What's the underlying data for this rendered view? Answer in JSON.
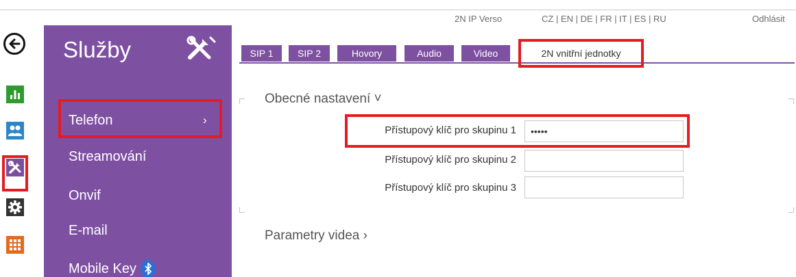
{
  "header": {
    "device_name": "2N IP Verso",
    "languages": "CZ | EN | DE | FR | IT | ES | RU",
    "logout": "Odhlásit"
  },
  "left_nav": {
    "items": [
      {
        "name": "status-icon",
        "color": "#2e9b2e"
      },
      {
        "name": "users-icon",
        "color": "#2c86c8"
      },
      {
        "name": "services-icon",
        "color": "#7b4f9e"
      },
      {
        "name": "system-icon",
        "color": "#333333"
      },
      {
        "name": "apps-icon",
        "color": "#e26b1d"
      }
    ]
  },
  "sidebar": {
    "title": "Služby",
    "items": [
      {
        "label": "Telefon"
      },
      {
        "label": "Streamování"
      },
      {
        "label": "Onvif"
      },
      {
        "label": "E-mail"
      },
      {
        "label": "Mobile Key"
      }
    ],
    "active_chevron": "›"
  },
  "tabs": [
    {
      "label": "SIP 1"
    },
    {
      "label": "SIP 2"
    },
    {
      "label": "Hovory"
    },
    {
      "label": "Audio"
    },
    {
      "label": "Video"
    },
    {
      "label": "2N vnitřní jednotky",
      "active": true
    }
  ],
  "sections": {
    "general_title": "Obecné nastavení ˅",
    "video_title": "Parametry videa ›"
  },
  "form": {
    "fields": [
      {
        "label": "Přístupový klíč pro skupinu 1",
        "value": "•••••"
      },
      {
        "label": "Přístupový klíč pro skupinu 2",
        "value": ""
      },
      {
        "label": "Přístupový klíč pro skupinu 3",
        "value": ""
      }
    ]
  },
  "colors": {
    "accent": "#7e50a2",
    "highlight": "#e31b23"
  }
}
